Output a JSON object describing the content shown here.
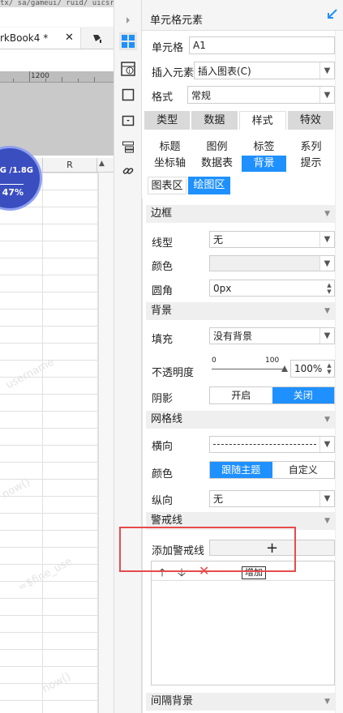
{
  "left": {
    "url_fragment": "tx/ sa/gameui/ ruid/ uicsr.iucoo/suscopcioy/ uiri\\",
    "workbook_tab": "rkBook4 *",
    "tab_close": "✕",
    "ruler_label": "1200",
    "column_header": "R",
    "gauge_top": "G /1.8G",
    "gauge_percent": "47%",
    "watermarks": [
      "username",
      "now()",
      "=$fine_use",
      "now()"
    ]
  },
  "toolbar": {
    "icons": [
      "expand-arrow-icon",
      "cell-element-icon",
      "cell-attribute-icon",
      "border-square-icon",
      "widget-icon",
      "condition-icon",
      "hyperlink-icon"
    ]
  },
  "panel": {
    "title": "单元格元素",
    "cell_label": "单元格",
    "cell_value": "A1",
    "insert_label": "插入元素",
    "insert_value": "插入图表(C)",
    "format_label": "格式",
    "format_value": "常规",
    "main_tabs": [
      "类型",
      "数据",
      "样式",
      "特效"
    ],
    "active_main_tab": "样式",
    "sub_tabs_row1": [
      "标题",
      "图例",
      "标签",
      "系列"
    ],
    "sub_tabs_row2": [
      "坐标轴",
      "数据表",
      "背景",
      "提示"
    ],
    "sub_tabs_row3": [
      "图表区",
      "绘图区"
    ],
    "active_sub_tab": "背景",
    "active_area_tab": "绘图区",
    "sections": {
      "border": {
        "title": "边框",
        "line_type_label": "线型",
        "line_type_value": "无",
        "color_label": "颜色",
        "radius_label": "圆角",
        "radius_value": "0px"
      },
      "background": {
        "title": "背景",
        "fill_label": "填充",
        "fill_value": "没有背景",
        "opacity_label": "不透明度",
        "opacity_min": "0",
        "opacity_max": "100",
        "opacity_value": "100%",
        "opacity_level": 1.0,
        "shadow_label": "阴影",
        "shadow_on": "开启",
        "shadow_off": "关闭"
      },
      "gridlines": {
        "title": "网格线",
        "horizontal_label": "横向",
        "color_label": "颜色",
        "color_follow": "跟随主题",
        "color_custom": "自定义",
        "vertical_label": "纵向",
        "vertical_value": "无"
      },
      "alert": {
        "title": "警戒线",
        "add_label": "添加警戒线",
        "add_symbol": "+",
        "tooltip": "增加"
      },
      "interval": {
        "title": "间隔背景"
      }
    },
    "colors": {
      "accent": "#1e90ff",
      "highlight": "#e84a4a",
      "orange": "#f5a623"
    }
  }
}
